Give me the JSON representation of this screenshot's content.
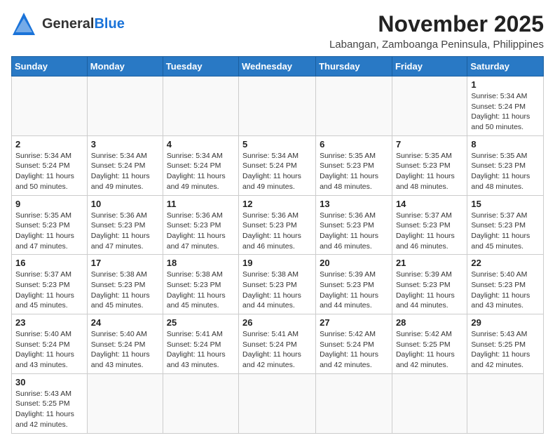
{
  "header": {
    "logo_general": "General",
    "logo_blue": "Blue",
    "month_title": "November 2025",
    "location": "Labangan, Zamboanga Peninsula, Philippines"
  },
  "days_of_week": [
    "Sunday",
    "Monday",
    "Tuesday",
    "Wednesday",
    "Thursday",
    "Friday",
    "Saturday"
  ],
  "weeks": [
    [
      {
        "day": "",
        "info": ""
      },
      {
        "day": "",
        "info": ""
      },
      {
        "day": "",
        "info": ""
      },
      {
        "day": "",
        "info": ""
      },
      {
        "day": "",
        "info": ""
      },
      {
        "day": "",
        "info": ""
      },
      {
        "day": "1",
        "info": "Sunrise: 5:34 AM\nSunset: 5:24 PM\nDaylight: 11 hours and 50 minutes."
      }
    ],
    [
      {
        "day": "2",
        "info": "Sunrise: 5:34 AM\nSunset: 5:24 PM\nDaylight: 11 hours and 50 minutes."
      },
      {
        "day": "3",
        "info": "Sunrise: 5:34 AM\nSunset: 5:24 PM\nDaylight: 11 hours and 49 minutes."
      },
      {
        "day": "4",
        "info": "Sunrise: 5:34 AM\nSunset: 5:24 PM\nDaylight: 11 hours and 49 minutes."
      },
      {
        "day": "5",
        "info": "Sunrise: 5:34 AM\nSunset: 5:24 PM\nDaylight: 11 hours and 49 minutes."
      },
      {
        "day": "6",
        "info": "Sunrise: 5:35 AM\nSunset: 5:23 PM\nDaylight: 11 hours and 48 minutes."
      },
      {
        "day": "7",
        "info": "Sunrise: 5:35 AM\nSunset: 5:23 PM\nDaylight: 11 hours and 48 minutes."
      },
      {
        "day": "8",
        "info": "Sunrise: 5:35 AM\nSunset: 5:23 PM\nDaylight: 11 hours and 48 minutes."
      }
    ],
    [
      {
        "day": "9",
        "info": "Sunrise: 5:35 AM\nSunset: 5:23 PM\nDaylight: 11 hours and 47 minutes."
      },
      {
        "day": "10",
        "info": "Sunrise: 5:36 AM\nSunset: 5:23 PM\nDaylight: 11 hours and 47 minutes."
      },
      {
        "day": "11",
        "info": "Sunrise: 5:36 AM\nSunset: 5:23 PM\nDaylight: 11 hours and 47 minutes."
      },
      {
        "day": "12",
        "info": "Sunrise: 5:36 AM\nSunset: 5:23 PM\nDaylight: 11 hours and 46 minutes."
      },
      {
        "day": "13",
        "info": "Sunrise: 5:36 AM\nSunset: 5:23 PM\nDaylight: 11 hours and 46 minutes."
      },
      {
        "day": "14",
        "info": "Sunrise: 5:37 AM\nSunset: 5:23 PM\nDaylight: 11 hours and 46 minutes."
      },
      {
        "day": "15",
        "info": "Sunrise: 5:37 AM\nSunset: 5:23 PM\nDaylight: 11 hours and 45 minutes."
      }
    ],
    [
      {
        "day": "16",
        "info": "Sunrise: 5:37 AM\nSunset: 5:23 PM\nDaylight: 11 hours and 45 minutes."
      },
      {
        "day": "17",
        "info": "Sunrise: 5:38 AM\nSunset: 5:23 PM\nDaylight: 11 hours and 45 minutes."
      },
      {
        "day": "18",
        "info": "Sunrise: 5:38 AM\nSunset: 5:23 PM\nDaylight: 11 hours and 45 minutes."
      },
      {
        "day": "19",
        "info": "Sunrise: 5:38 AM\nSunset: 5:23 PM\nDaylight: 11 hours and 44 minutes."
      },
      {
        "day": "20",
        "info": "Sunrise: 5:39 AM\nSunset: 5:23 PM\nDaylight: 11 hours and 44 minutes."
      },
      {
        "day": "21",
        "info": "Sunrise: 5:39 AM\nSunset: 5:23 PM\nDaylight: 11 hours and 44 minutes."
      },
      {
        "day": "22",
        "info": "Sunrise: 5:40 AM\nSunset: 5:23 PM\nDaylight: 11 hours and 43 minutes."
      }
    ],
    [
      {
        "day": "23",
        "info": "Sunrise: 5:40 AM\nSunset: 5:24 PM\nDaylight: 11 hours and 43 minutes."
      },
      {
        "day": "24",
        "info": "Sunrise: 5:40 AM\nSunset: 5:24 PM\nDaylight: 11 hours and 43 minutes."
      },
      {
        "day": "25",
        "info": "Sunrise: 5:41 AM\nSunset: 5:24 PM\nDaylight: 11 hours and 43 minutes."
      },
      {
        "day": "26",
        "info": "Sunrise: 5:41 AM\nSunset: 5:24 PM\nDaylight: 11 hours and 42 minutes."
      },
      {
        "day": "27",
        "info": "Sunrise: 5:42 AM\nSunset: 5:24 PM\nDaylight: 11 hours and 42 minutes."
      },
      {
        "day": "28",
        "info": "Sunrise: 5:42 AM\nSunset: 5:25 PM\nDaylight: 11 hours and 42 minutes."
      },
      {
        "day": "29",
        "info": "Sunrise: 5:43 AM\nSunset: 5:25 PM\nDaylight: 11 hours and 42 minutes."
      }
    ],
    [
      {
        "day": "30",
        "info": "Sunrise: 5:43 AM\nSunset: 5:25 PM\nDaylight: 11 hours and 42 minutes."
      },
      {
        "day": "",
        "info": ""
      },
      {
        "day": "",
        "info": ""
      },
      {
        "day": "",
        "info": ""
      },
      {
        "day": "",
        "info": ""
      },
      {
        "day": "",
        "info": ""
      },
      {
        "day": "",
        "info": ""
      }
    ]
  ]
}
